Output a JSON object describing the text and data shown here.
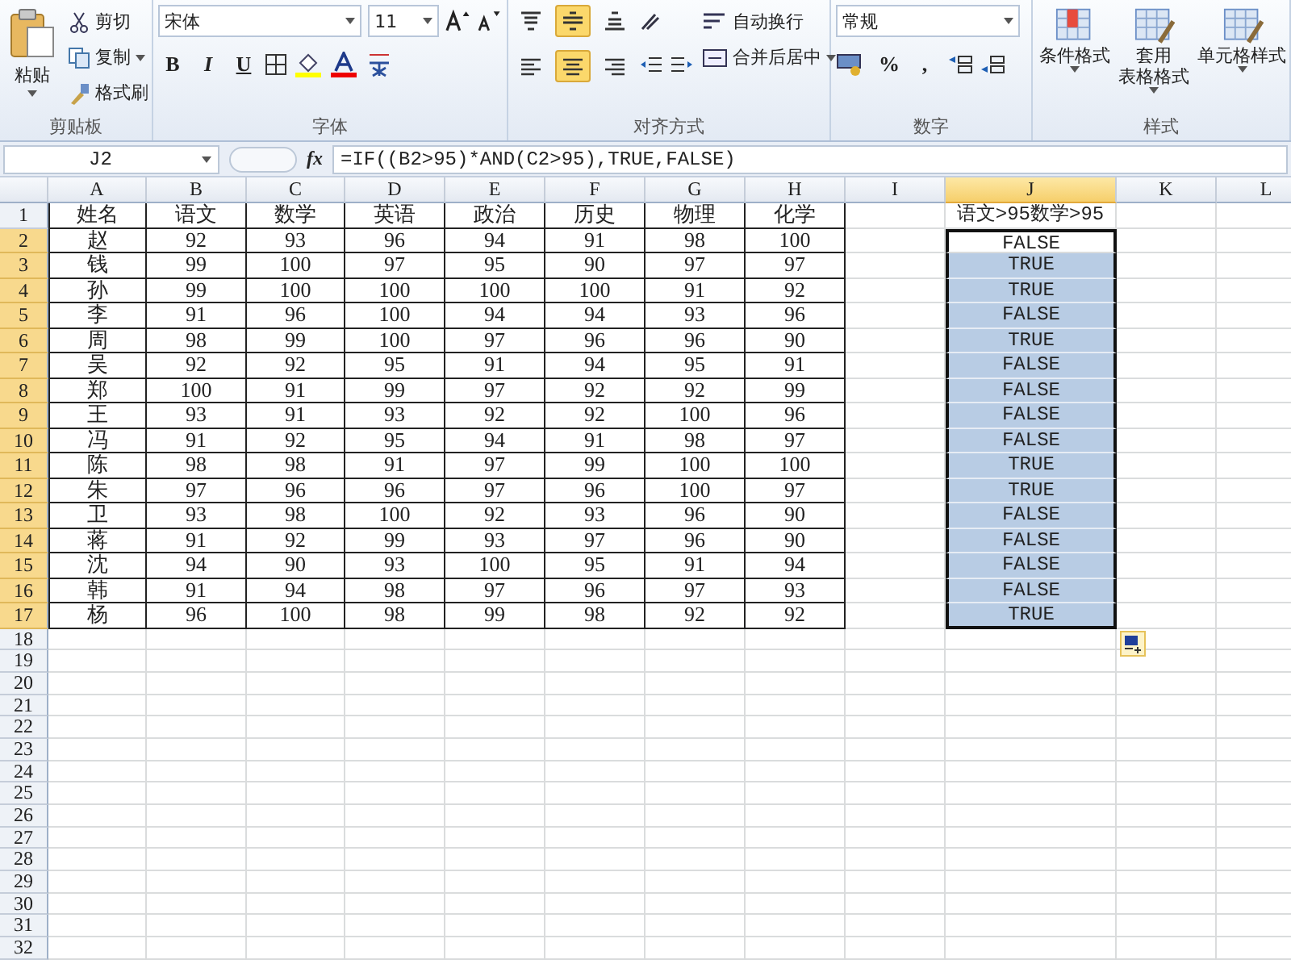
{
  "ribbon": {
    "clipboard": {
      "paste": "粘贴",
      "items": [
        {
          "kind": "cut",
          "label": "剪切"
        },
        {
          "kind": "copy",
          "label": "复制"
        },
        {
          "kind": "painter",
          "label": "格式刷"
        }
      ],
      "label": "剪贴板"
    },
    "font": {
      "name": "宋体",
      "size": "11",
      "styles": [
        "B",
        "I",
        "U"
      ],
      "label": "字体"
    },
    "alignment": {
      "vertical": [
        {
          "selected": false
        },
        {
          "selected": true
        },
        {
          "selected": false
        }
      ],
      "horizontal": [
        {
          "selected": false
        },
        {
          "selected": true
        },
        {
          "selected": false
        }
      ],
      "wrap": "自动换行",
      "merge": "合并后居中",
      "label": "对齐方式"
    },
    "number": {
      "format": "常规",
      "percent": "%",
      "comma": ",",
      "label": "数字"
    },
    "styles": {
      "items": [
        {
          "lines": [
            "条件格式"
          ]
        },
        {
          "lines": [
            "套用",
            "表格格式"
          ]
        },
        {
          "lines": [
            "单元格样式"
          ]
        }
      ],
      "label": "样式"
    }
  },
  "formula_bar": {
    "name_box": "J2",
    "fx": "fx",
    "formula": "=IF((B2>95)*AND(C2>95),TRUE,FALSE)"
  },
  "columns": [
    {
      "label": "A",
      "selected": false
    },
    {
      "label": "B",
      "selected": false
    },
    {
      "label": "C",
      "selected": false
    },
    {
      "label": "D",
      "selected": false
    },
    {
      "label": "E",
      "selected": false
    },
    {
      "label": "F",
      "selected": false
    },
    {
      "label": "G",
      "selected": false
    },
    {
      "label": "H",
      "selected": false
    },
    {
      "label": "I",
      "selected": false
    },
    {
      "label": "J",
      "selected": true
    },
    {
      "label": "K",
      "selected": false
    },
    {
      "label": "L",
      "selected": false
    }
  ],
  "rows": [
    {
      "number": "1",
      "selected": false,
      "active": false,
      "cells": [
        "姓名",
        "语文",
        "数学",
        "英语",
        "政治",
        "历史",
        "物理",
        "化学"
      ],
      "result": "语文>95数学>95"
    },
    {
      "number": "2",
      "selected": true,
      "active": true,
      "cells": [
        "赵",
        "92",
        "93",
        "96",
        "94",
        "91",
        "98",
        "100"
      ],
      "result": "FALSE"
    },
    {
      "number": "3",
      "selected": true,
      "active": false,
      "cells": [
        "钱",
        "99",
        "100",
        "97",
        "95",
        "90",
        "97",
        "97"
      ],
      "result": "TRUE"
    },
    {
      "number": "4",
      "selected": true,
      "active": false,
      "cells": [
        "孙",
        "99",
        "100",
        "100",
        "100",
        "100",
        "91",
        "92"
      ],
      "result": "TRUE"
    },
    {
      "number": "5",
      "selected": true,
      "active": false,
      "cells": [
        "李",
        "91",
        "96",
        "100",
        "94",
        "94",
        "93",
        "96"
      ],
      "result": "FALSE"
    },
    {
      "number": "6",
      "selected": true,
      "active": false,
      "cells": [
        "周",
        "98",
        "99",
        "100",
        "97",
        "96",
        "96",
        "90"
      ],
      "result": "TRUE"
    },
    {
      "number": "7",
      "selected": true,
      "active": false,
      "cells": [
        "吴",
        "92",
        "92",
        "95",
        "91",
        "94",
        "95",
        "91"
      ],
      "result": "FALSE"
    },
    {
      "number": "8",
      "selected": true,
      "active": false,
      "cells": [
        "郑",
        "100",
        "91",
        "99",
        "97",
        "92",
        "92",
        "99"
      ],
      "result": "FALSE"
    },
    {
      "number": "9",
      "selected": true,
      "active": false,
      "cells": [
        "王",
        "93",
        "91",
        "93",
        "92",
        "92",
        "100",
        "96"
      ],
      "result": "FALSE"
    },
    {
      "number": "10",
      "selected": true,
      "active": false,
      "cells": [
        "冯",
        "91",
        "92",
        "95",
        "94",
        "91",
        "98",
        "97"
      ],
      "result": "FALSE"
    },
    {
      "number": "11",
      "selected": true,
      "active": false,
      "cells": [
        "陈",
        "98",
        "98",
        "91",
        "97",
        "99",
        "100",
        "100"
      ],
      "result": "TRUE"
    },
    {
      "number": "12",
      "selected": true,
      "active": false,
      "cells": [
        "朱",
        "97",
        "96",
        "96",
        "97",
        "96",
        "100",
        "97"
      ],
      "result": "TRUE"
    },
    {
      "number": "13",
      "selected": true,
      "active": false,
      "cells": [
        "卫",
        "93",
        "98",
        "100",
        "92",
        "93",
        "96",
        "90"
      ],
      "result": "FALSE"
    },
    {
      "number": "14",
      "selected": true,
      "active": false,
      "cells": [
        "蒋",
        "91",
        "92",
        "99",
        "93",
        "97",
        "96",
        "90"
      ],
      "result": "FALSE"
    },
    {
      "number": "15",
      "selected": true,
      "active": false,
      "cells": [
        "沈",
        "94",
        "90",
        "93",
        "100",
        "95",
        "91",
        "94"
      ],
      "result": "FALSE"
    },
    {
      "number": "16",
      "selected": true,
      "active": false,
      "cells": [
        "韩",
        "91",
        "94",
        "98",
        "97",
        "96",
        "97",
        "93"
      ],
      "result": "FALSE"
    },
    {
      "number": "17",
      "selected": true,
      "active": false,
      "cells": [
        "杨",
        "96",
        "100",
        "98",
        "99",
        "98",
        "92",
        "92"
      ],
      "result": "TRUE"
    }
  ],
  "empty_rows": [
    "18",
    "19",
    "20",
    "21",
    "22",
    "23",
    "24",
    "25",
    "26",
    "27",
    "28",
    "29",
    "30",
    "31",
    "32"
  ]
}
